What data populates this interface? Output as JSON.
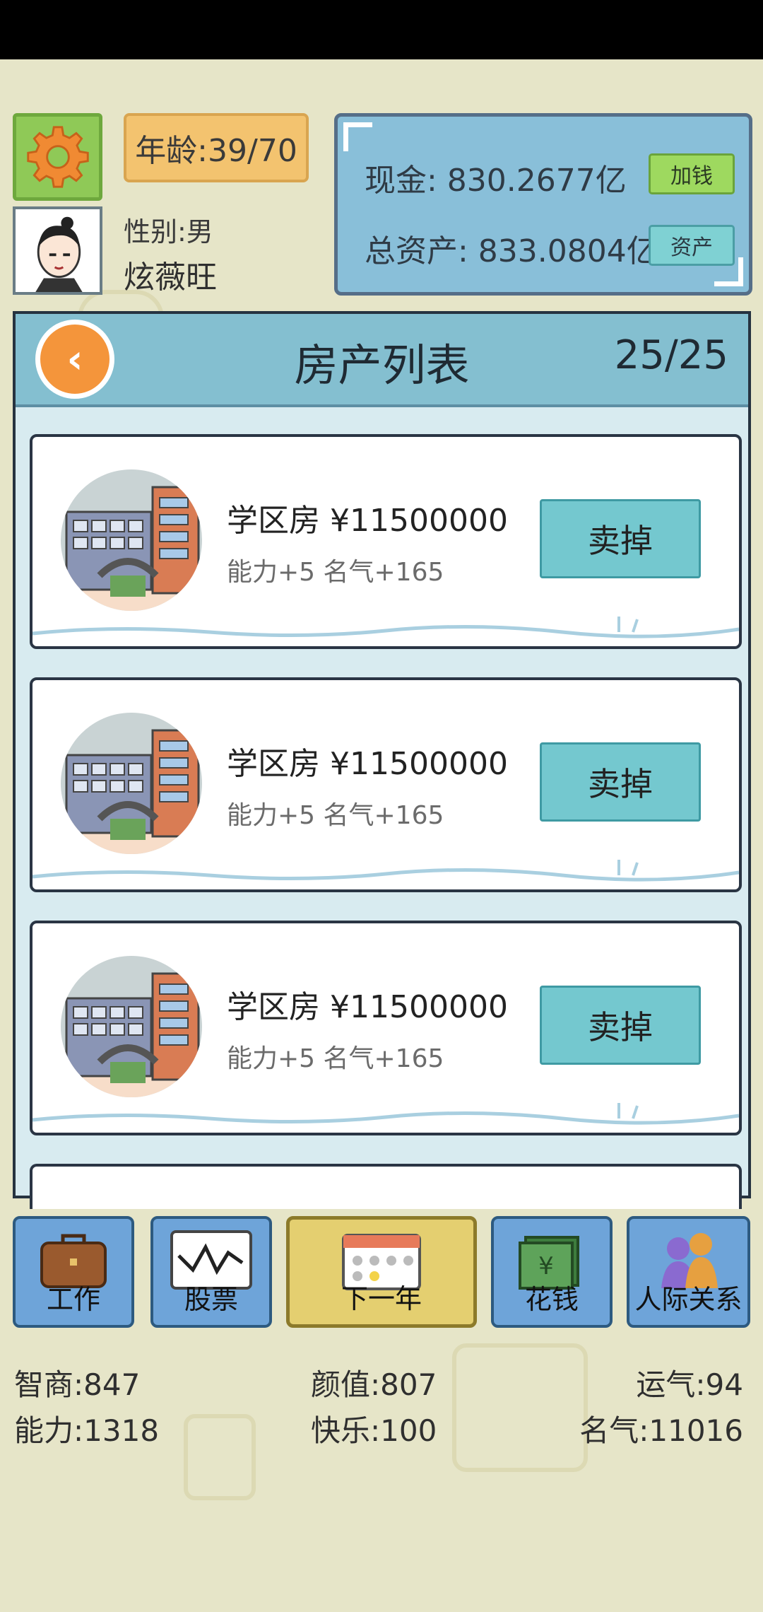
{
  "player": {
    "age": "年龄:39/70",
    "gender": "性别:男",
    "name": "炫薇旺"
  },
  "money": {
    "cash": "现金: 830.2677亿",
    "total_assets": "总资产: 833.0804亿",
    "add_money_label": "加钱",
    "assets_label": "资产"
  },
  "property_list": {
    "title": "房产列表",
    "count": "25/25",
    "items": [
      {
        "name": "学区房 ¥11500000",
        "stats": "能力+5 名气+165",
        "action": "卖掉"
      },
      {
        "name": "学区房 ¥11500000",
        "stats": "能力+5 名气+165",
        "action": "卖掉"
      },
      {
        "name": "学区房 ¥11500000",
        "stats": "能力+5 名气+165",
        "action": "卖掉"
      }
    ]
  },
  "nav": [
    {
      "label": "工作",
      "icon": "briefcase-icon"
    },
    {
      "label": "股票",
      "icon": "stock-chart-icon"
    },
    {
      "label": "下一年",
      "icon": "calendar-icon"
    },
    {
      "label": "花钱",
      "icon": "money-stack-icon"
    },
    {
      "label": "人际关系",
      "icon": "people-icon"
    }
  ],
  "stats": {
    "iq": "智商:847",
    "looks": "颜值:807",
    "luck": "运气:94",
    "ability": "能力:1318",
    "happiness": "快乐:100",
    "fame": "名气:11016"
  },
  "colors": {
    "background": "#e6e5c8",
    "panel_blue": "#89bfd9",
    "sell_button": "#74c8cf",
    "back_button": "#f4953b",
    "settings_green": "#8fc957"
  }
}
